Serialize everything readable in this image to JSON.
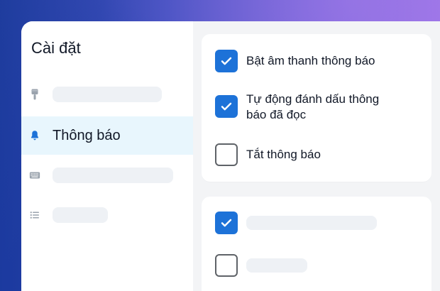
{
  "sidebar": {
    "title": "Cài đặt",
    "items": [
      {
        "icon": "paintbrush-icon",
        "label": ""
      },
      {
        "icon": "bell-icon",
        "label": "Thông báo",
        "active": true
      },
      {
        "icon": "keyboard-icon",
        "label": ""
      },
      {
        "icon": "list-icon",
        "label": ""
      }
    ]
  },
  "content": {
    "options": [
      {
        "label": "Bật âm thanh thông báo",
        "checked": true
      },
      {
        "label": "Tự động đánh dấu thông báo đã đọc",
        "checked": true
      },
      {
        "label": "Tắt thông báo",
        "checked": false
      }
    ],
    "second_card": [
      {
        "checked": true
      },
      {
        "checked": false
      }
    ]
  },
  "colors": {
    "accent": "#1d72d8",
    "active_bg": "#e8f6fd",
    "icon_gray": "#9aa3ad",
    "placeholder": "#eef1f5"
  }
}
